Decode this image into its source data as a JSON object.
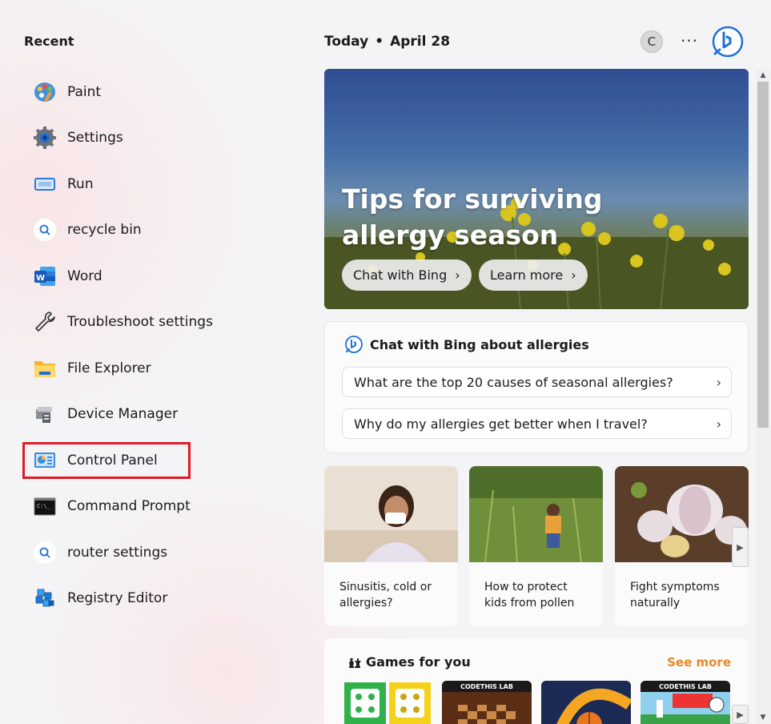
{
  "recent": {
    "title": "Recent",
    "items": [
      {
        "label": "Paint",
        "icon": "paint-icon"
      },
      {
        "label": "Settings",
        "icon": "gear-icon"
      },
      {
        "label": "Run",
        "icon": "run-icon"
      },
      {
        "label": "recycle bin",
        "icon": "search-icon"
      },
      {
        "label": "Word",
        "icon": "word-icon"
      },
      {
        "label": "Troubleshoot settings",
        "icon": "wrench-icon"
      },
      {
        "label": "File Explorer",
        "icon": "folder-icon"
      },
      {
        "label": "Device Manager",
        "icon": "device-manager-icon"
      },
      {
        "label": "Control Panel",
        "icon": "control-panel-icon",
        "highlighted": true
      },
      {
        "label": "Command Prompt",
        "icon": "terminal-icon"
      },
      {
        "label": "router settings",
        "icon": "search-icon"
      },
      {
        "label": "Registry Editor",
        "icon": "registry-icon"
      }
    ]
  },
  "header": {
    "today": "Today",
    "separator": "•",
    "date": "April 28",
    "avatar_initial": "C",
    "more_label": "···"
  },
  "hero": {
    "title": "Tips for surviving allergy season",
    "buttons": [
      "Chat with Bing",
      "Learn more"
    ]
  },
  "chat": {
    "title": "Chat with Bing about allergies",
    "questions": [
      "What are the top 20 causes of seasonal allergies?",
      "Why do my allergies get better when I travel?"
    ]
  },
  "cards": [
    {
      "caption": "Sinusitis, cold or allergies?"
    },
    {
      "caption": "How to protect kids from pollen"
    },
    {
      "caption": "Fight symptoms naturally"
    }
  ],
  "games": {
    "title": "Games for you",
    "see_more": "See more",
    "badge": "CODETHIS LAB"
  },
  "colors": {
    "highlight": "#e01b24",
    "accent_orange": "#e58a2a",
    "bing_blue": "#1f6fd6"
  }
}
